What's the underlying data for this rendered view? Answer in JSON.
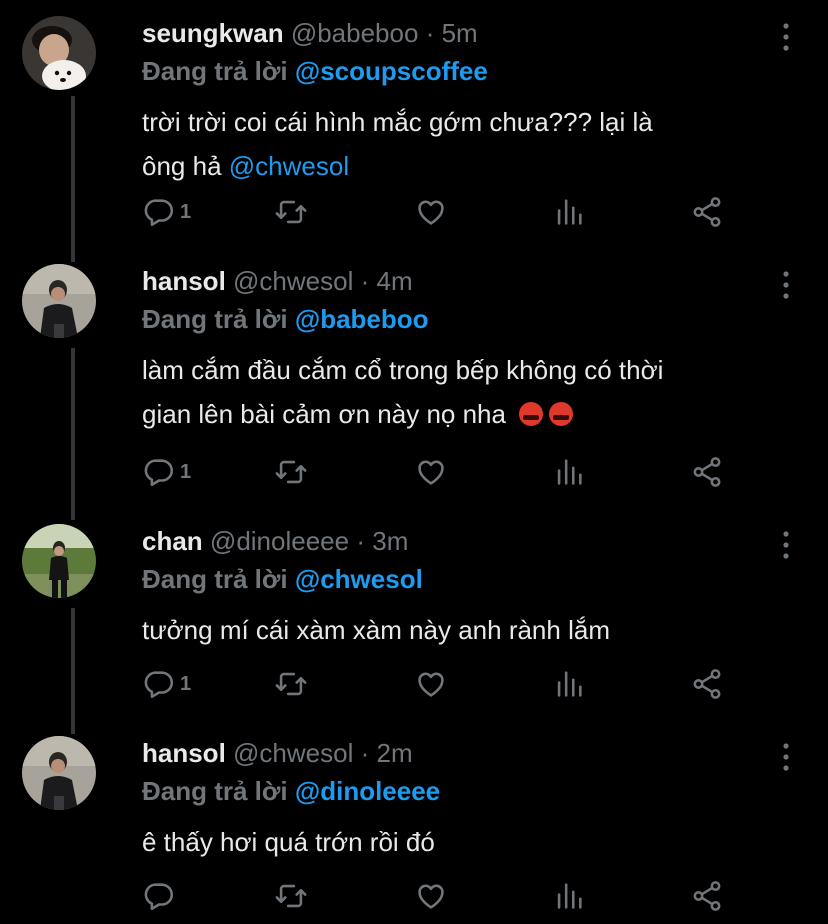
{
  "theme": {
    "background": "#000000",
    "text": "#e7e9ea",
    "muted": "#71767b",
    "accent": "#1d9bf0",
    "thread_line": "#333639"
  },
  "reply_prefix": "Đang trả lời",
  "tweets": [
    {
      "name": "seungkwan",
      "handle": "@babeboo",
      "time": "5m",
      "reply_to": "@scoupscoffee",
      "text_line1": "trời trời coi cái hình mắc gớm chưa??? lại là",
      "text_line2": "ông hả",
      "text_mention": "@chwesol",
      "reply_count": "1",
      "avatar": "avatar-with-white-dog"
    },
    {
      "name": "hansol",
      "handle": "@chwesol",
      "time": "4m",
      "reply_to": "@babeboo",
      "text_line1": "làm cắm đầu cắm cổ trong bếp không có thời",
      "text_line2": "gian lên bài cảm ơn này nọ nha",
      "emoji": [
        "angry-face-emoji",
        "angry-face-emoji"
      ],
      "reply_count": "1",
      "avatar": "avatar-person-dark-jacket"
    },
    {
      "name": "chan",
      "handle": "@dinoleeee",
      "time": "3m",
      "reply_to": "@chwesol",
      "text_line1": "tưởng mí cái xàm xàm này anh rành lắm",
      "reply_count": "1",
      "avatar": "avatar-person-in-park"
    },
    {
      "name": "hansol",
      "handle": "@chwesol",
      "time": "2m",
      "reply_to": "@dinoleeee",
      "text_line1": "ê thấy hơi quá trớn rồi đó",
      "reply_count": "",
      "avatar": "avatar-person-dark-jacket"
    }
  ],
  "icons": {
    "reply": "reply-icon",
    "retweet": "retweet-icon",
    "like": "like-icon",
    "analytics": "analytics-icon",
    "share": "share-icon",
    "more": "more-icon"
  }
}
